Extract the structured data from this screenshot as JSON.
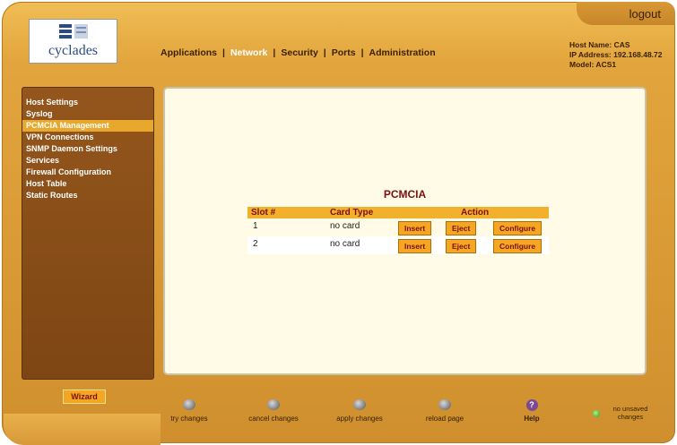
{
  "header": {
    "logout_label": "logout",
    "logo_text": "cyclades",
    "nav": [
      {
        "label": "Applications"
      },
      {
        "label": "Network"
      },
      {
        "label": "Security"
      },
      {
        "label": "Ports"
      },
      {
        "label": "Administration"
      }
    ],
    "active_nav": "Network",
    "host_name": "Host Name: CAS",
    "ip_address": "IP Address: 192.168.48.72",
    "model": "Model: ACS1"
  },
  "sidebar": {
    "items": [
      {
        "label": "Host Settings"
      },
      {
        "label": "Syslog"
      },
      {
        "label": "PCMCIA Management"
      },
      {
        "label": "VPN Connections"
      },
      {
        "label": "SNMP Daemon Settings"
      },
      {
        "label": "Services"
      },
      {
        "label": "Firewall Configuration"
      },
      {
        "label": "Host Table"
      },
      {
        "label": "Static Routes"
      }
    ],
    "selected": "PCMCIA Management"
  },
  "pcmcia": {
    "title": "PCMCIA",
    "columns": {
      "slot": "Slot #",
      "card_type": "Card Type",
      "action": "Action"
    },
    "rows": [
      {
        "slot": "1",
        "card_type": "no card",
        "insert": "Insert",
        "eject": "Eject",
        "configure": "Configure"
      },
      {
        "slot": "2",
        "card_type": "no card",
        "insert": "Insert",
        "eject": "Eject",
        "configure": "Configure"
      }
    ]
  },
  "footer": {
    "wizard_label": "Wizard",
    "actions": {
      "try": "try changes",
      "cancel": "cancel changes",
      "apply": "apply changes",
      "reload": "reload page",
      "help": "Help"
    },
    "status_line1": "no unsaved",
    "status_line2": "changes"
  },
  "colors": {
    "frame": "#e2a43c",
    "sidebar": "#8b4f18",
    "selected_item": "#e8a82e",
    "content_bg": "#fffbe6",
    "button": "#f5a623",
    "title_text": "#7a1010"
  }
}
